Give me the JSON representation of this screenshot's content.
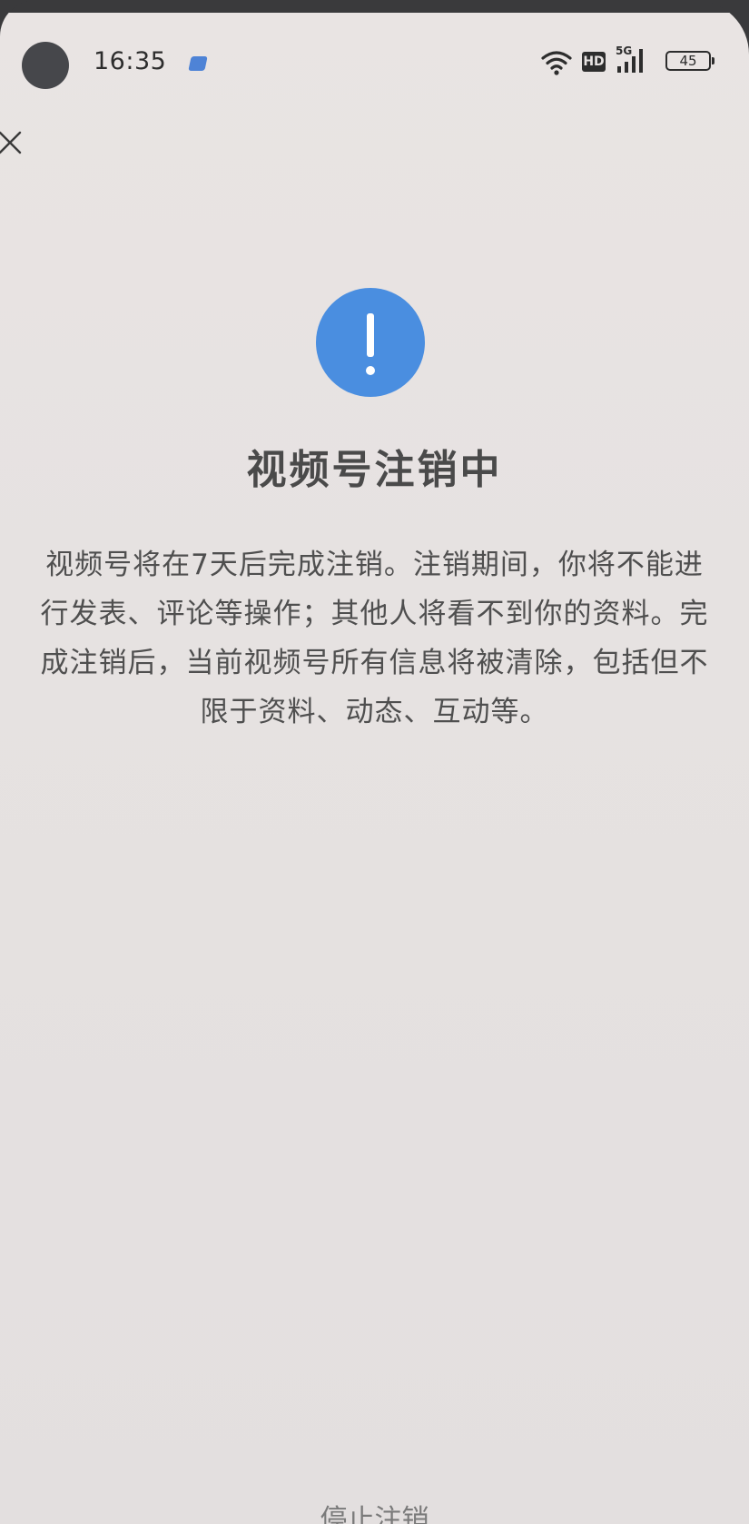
{
  "status_bar": {
    "time": "16:35",
    "network": "5G",
    "hd_label": "HD",
    "battery_level": "45"
  },
  "header": {
    "close_icon": "close-icon"
  },
  "alert": {
    "icon": "exclamation-icon",
    "accent_color": "#4a8ee0"
  },
  "main": {
    "title": "视频号注销中",
    "description": "视频号将在7天后完成注销。注销期间，你将不能进行发表、评论等操作；其他人将看不到你的资料。完成注销后，当前视频号所有信息将被清除，包括但不限于资料、动态、互动等。"
  },
  "footer": {
    "cancel_label": "停止注销"
  }
}
